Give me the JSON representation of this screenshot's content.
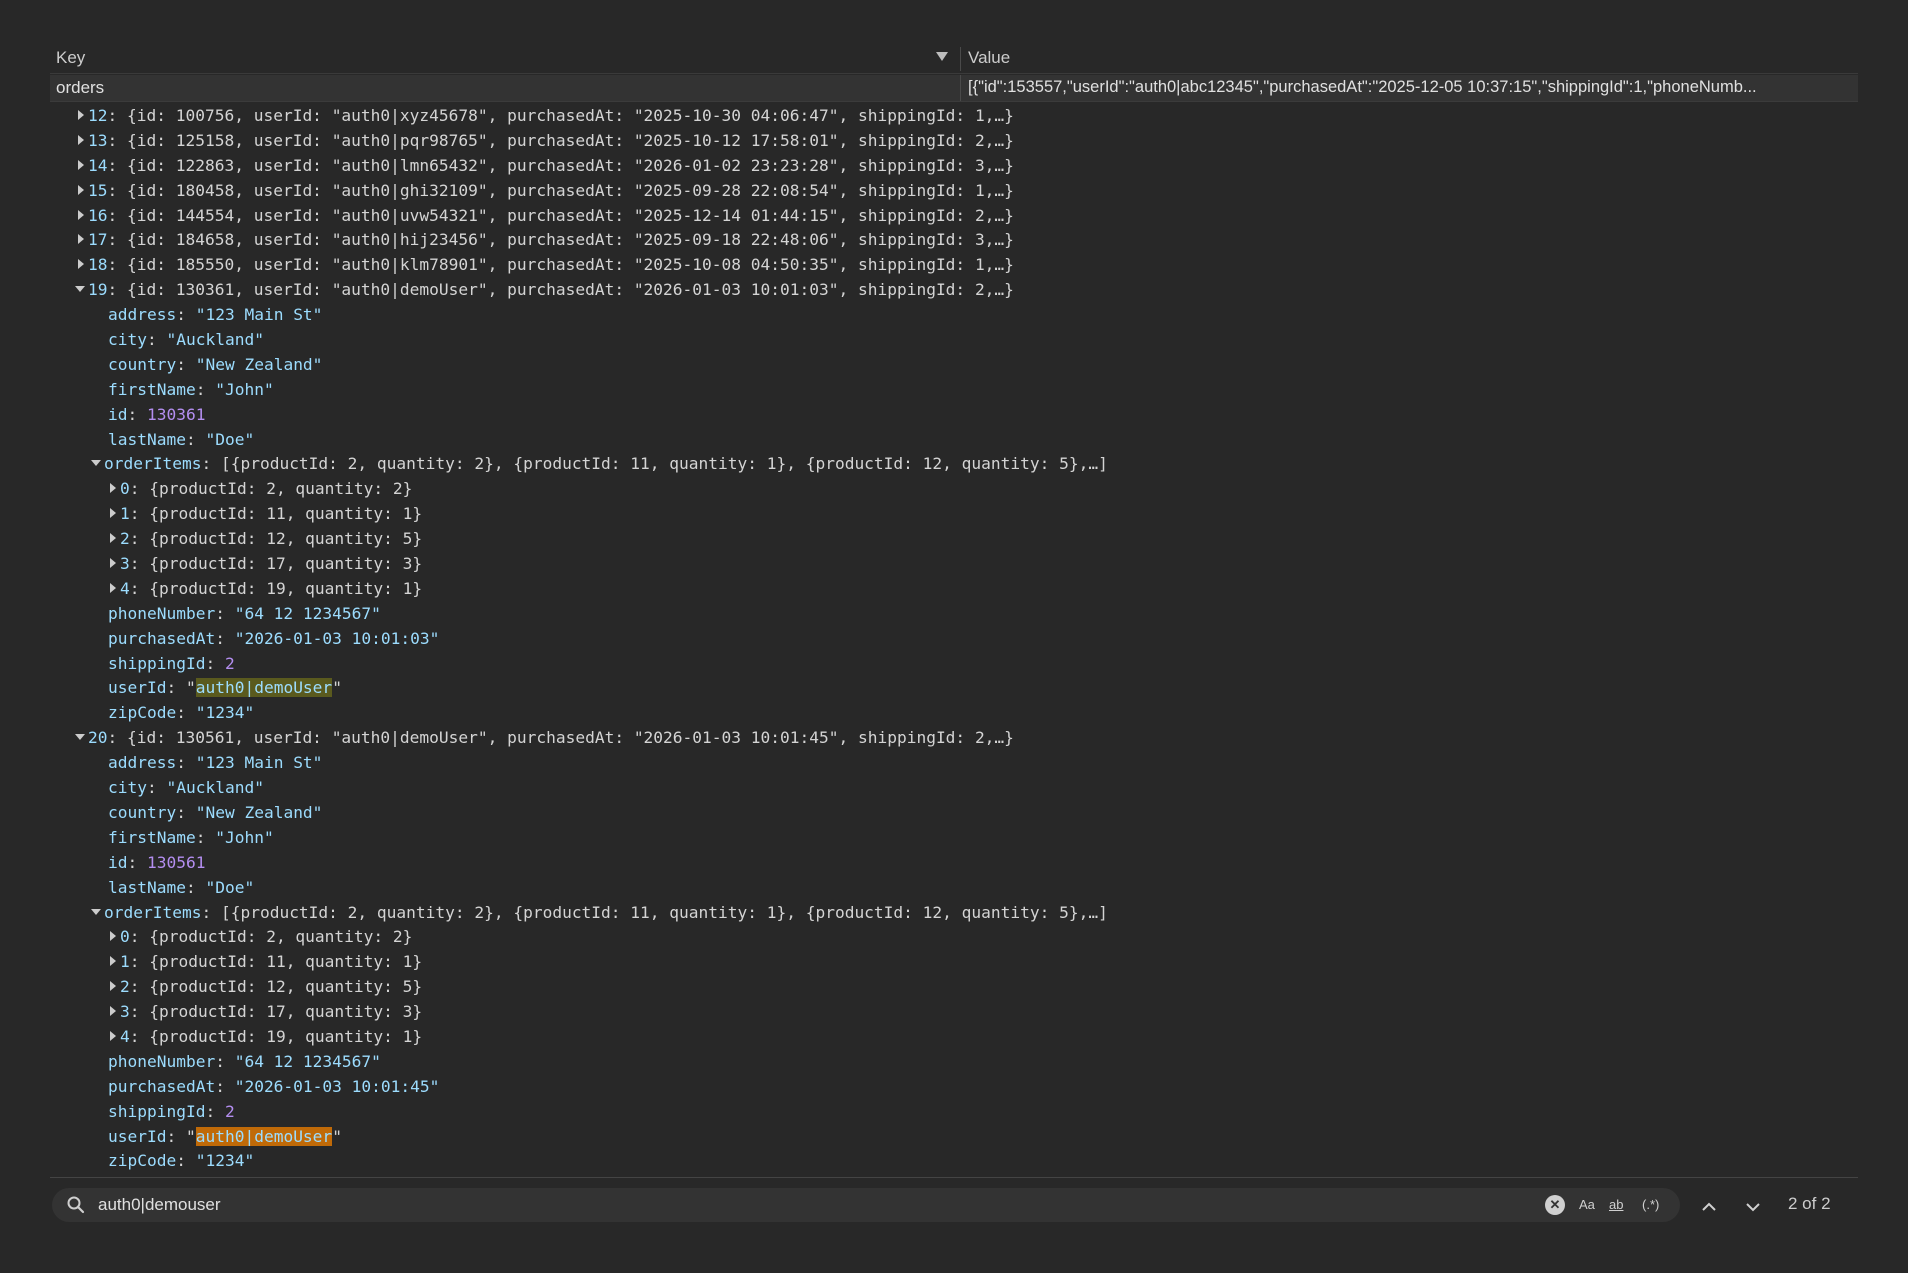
{
  "header": {
    "key_label": "Key",
    "value_label": "Value"
  },
  "row": {
    "key": "orders",
    "value": "[{\"id\":153557,\"userId\":\"auth0|abc12345\",\"purchasedAt\":\"2025-12-05 10:37:15\",\"shippingId\":1,\"phoneNumb..."
  },
  "tree": {
    "collapsed_orders": [
      {
        "index": "12",
        "id": "100756",
        "userId": "\"auth0|xyz45678\"",
        "purchasedAt": "\"2025-10-30 04:06:47\"",
        "shippingId": "1,…}"
      },
      {
        "index": "13",
        "id": "125158",
        "userId": "\"auth0|pqr98765\"",
        "purchasedAt": "\"2025-10-12 17:58:01\"",
        "shippingId": "2,…}"
      },
      {
        "index": "14",
        "id": "122863",
        "userId": "\"auth0|lmn65432\"",
        "purchasedAt": "\"2026-01-02 23:23:28\"",
        "shippingId": "3,…}"
      },
      {
        "index": "15",
        "id": "180458",
        "userId": "\"auth0|ghi32109\"",
        "purchasedAt": "\"2025-09-28 22:08:54\"",
        "shippingId": "1,…}"
      },
      {
        "index": "16",
        "id": "144554",
        "userId": "\"auth0|uvw54321\"",
        "purchasedAt": "\"2025-12-14 01:44:15\"",
        "shippingId": "2,…}"
      },
      {
        "index": "17",
        "id": "184658",
        "userId": "\"auth0|hij23456\"",
        "purchasedAt": "\"2025-09-18 22:48:06\"",
        "shippingId": "3,…}"
      },
      {
        "index": "18",
        "id": "185550",
        "userId": "\"auth0|klm78901\"",
        "purchasedAt": "\"2025-10-08 04:50:35\"",
        "shippingId": "1,…}"
      }
    ],
    "expanded_orders": [
      {
        "index": "19",
        "id": "130361",
        "userId": "\"auth0|demoUser\"",
        "purchasedAt": "\"2026-01-03 10:01:03\"",
        "shippingId": "2,…}",
        "address": "\"123 Main St\"",
        "city": "\"Auckland\"",
        "country": "\"New Zealand\"",
        "firstName": "\"John\"",
        "id_value": "130361",
        "lastName": "\"Doe\"",
        "orderItems_summary": "[{productId: 2, quantity: 2}, {productId: 11, quantity: 1}, {productId: 12, quantity: 5},…]",
        "items": [
          {
            "index": "0",
            "text": "{productId: 2, quantity: 2}"
          },
          {
            "index": "1",
            "text": "{productId: 11, quantity: 1}"
          },
          {
            "index": "2",
            "text": "{productId: 12, quantity: 5}"
          },
          {
            "index": "3",
            "text": "{productId: 17, quantity: 3}"
          },
          {
            "index": "4",
            "text": "{productId: 19, quantity: 1}"
          }
        ],
        "phoneNumber": "\"64 12 1234567\"",
        "purchasedAt_value": "\"2026-01-03 10:01:03\"",
        "shippingId_value": "2",
        "userId_match": "auth0|demoUser",
        "zipCode": "\"1234\""
      },
      {
        "index": "20",
        "id": "130561",
        "userId": "\"auth0|demoUser\"",
        "purchasedAt": "\"2026-01-03 10:01:45\"",
        "shippingId": "2,…}",
        "address": "\"123 Main St\"",
        "city": "\"Auckland\"",
        "country": "\"New Zealand\"",
        "firstName": "\"John\"",
        "id_value": "130561",
        "lastName": "\"Doe\"",
        "orderItems_summary": "[{productId: 2, quantity: 2}, {productId: 11, quantity: 1}, {productId: 12, quantity: 5},…]",
        "items": [
          {
            "index": "0",
            "text": "{productId: 2, quantity: 2}"
          },
          {
            "index": "1",
            "text": "{productId: 11, quantity: 1}"
          },
          {
            "index": "2",
            "text": "{productId: 12, quantity: 5}"
          },
          {
            "index": "3",
            "text": "{productId: 17, quantity: 3}"
          },
          {
            "index": "4",
            "text": "{productId: 19, quantity: 1}"
          }
        ],
        "phoneNumber": "\"64 12 1234567\"",
        "purchasedAt_value": "\"2026-01-03 10:01:45\"",
        "shippingId_value": "2",
        "userId_match": "auth0|demoUser",
        "zipCode": "\"1234\""
      }
    ]
  },
  "search": {
    "value": "auth0|demouser",
    "match_case_label": "Aa",
    "whole_word_label": "ab",
    "regex_label": "(.*)",
    "match_count": "2 of 2"
  },
  "colors": {
    "background": "#282828",
    "key": "#9cdcfe",
    "number": "#b48ef0",
    "match": "#5a5a1e",
    "active_match": "#c06a08"
  },
  "icons": [
    "sort-dropdown-icon",
    "chevron-right-icon",
    "chevron-down-icon",
    "search-icon",
    "clear-icon",
    "arrow-up-icon",
    "arrow-down-icon"
  ]
}
